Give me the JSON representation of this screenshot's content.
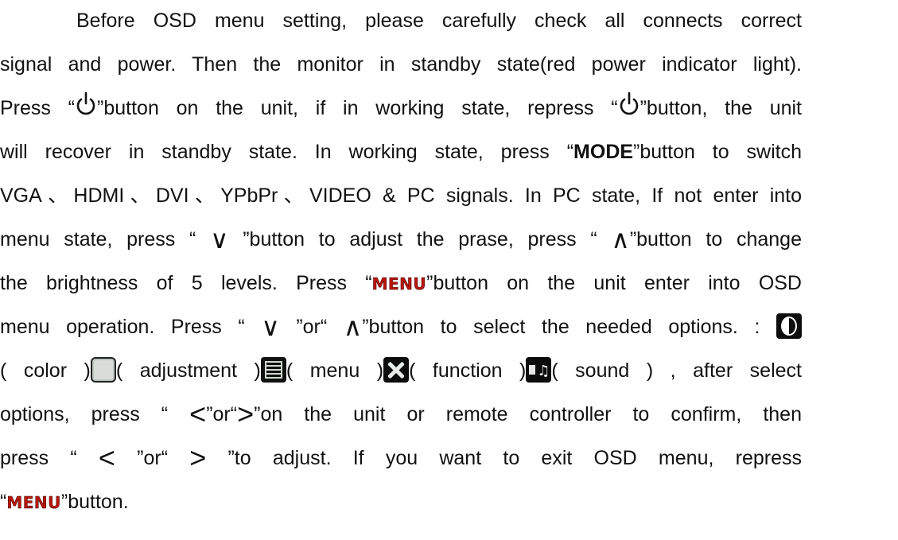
{
  "lines": [
    {
      "t1": "Before OSD menu setting, please carefully check all connects correct"
    },
    {
      "t1": "signal and power. Then the monitor in standby state(red power indicator light)."
    },
    {
      "t1": "Press “",
      "t2": "”button on the unit, if in working state, repress “",
      "t3": "”button, the unit"
    },
    {
      "t1": "will recover in standby state. In working state, press “",
      "kw": "MODE",
      "t2": "”button to switch"
    },
    {
      "t1": "VGA、HDMI、DVI、YPbPr、VIDEO & PC signals. In PC state, If not enter into"
    },
    {
      "t1": "menu state, press “ ",
      "g1": "∨",
      "t2": " ”button to adjust the prase, press “ ",
      "g2": "∧",
      "t3": "”button to change"
    },
    {
      "t1": "the brightness of 5 levels. Press “",
      "kw": "MENU",
      "t2": "”button on the unit enter into OSD"
    },
    {
      "t1": "menu operation. Press “ ",
      "g1": "∨",
      "t2": " ”or“ ",
      "g2": "∧",
      "t3": "”button to select the needed options.  : "
    },
    {
      "t1": " ( color )",
      "t2": "( adjustment )",
      "t3": "( menu )",
      "t4": "( function )",
      "t5": "( sound ) , after select"
    },
    {
      "t1": "options, press “ ",
      "g1": "<",
      "t2": "”or“",
      "g2": ">",
      "t3": "”on the unit or remote controller to confirm, then"
    },
    {
      "t1": "press “  ",
      "g1": "<",
      "t2": " ”or“ ",
      "g2": ">",
      "t3": " ”to adjust. If you want to exit OSD menu, repress"
    },
    {
      "t1": "“",
      "kw": "MENU",
      "t2": "”button."
    }
  ],
  "icons": {
    "power": "power-icon",
    "color": "color-icon",
    "adjustment": "adjustment-icon",
    "menu": "menu-icon",
    "function": "function-icon",
    "sound": "sound-icon"
  },
  "colors": {
    "text": "#111111",
    "menu_keyword": "#b8160e"
  }
}
